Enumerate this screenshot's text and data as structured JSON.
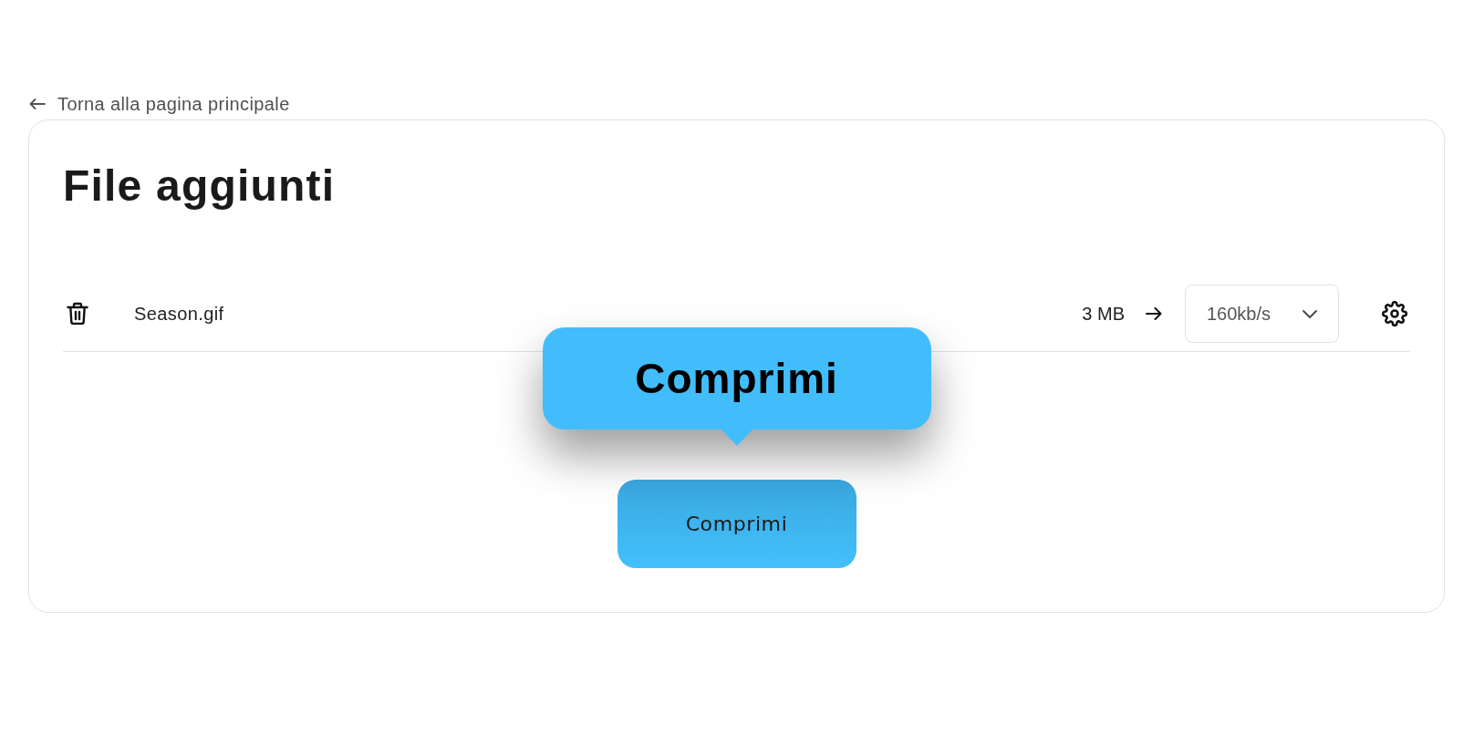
{
  "back_link": {
    "label": "Torna alla pagina principale"
  },
  "card": {
    "title": "File aggiunti",
    "files": [
      {
        "name": "Season.gif",
        "size": "3 MB",
        "bitrate": "160kb/s"
      }
    ],
    "compress_button": {
      "label": "Comprimi"
    },
    "tooltip": {
      "text": "Comprimi"
    }
  }
}
